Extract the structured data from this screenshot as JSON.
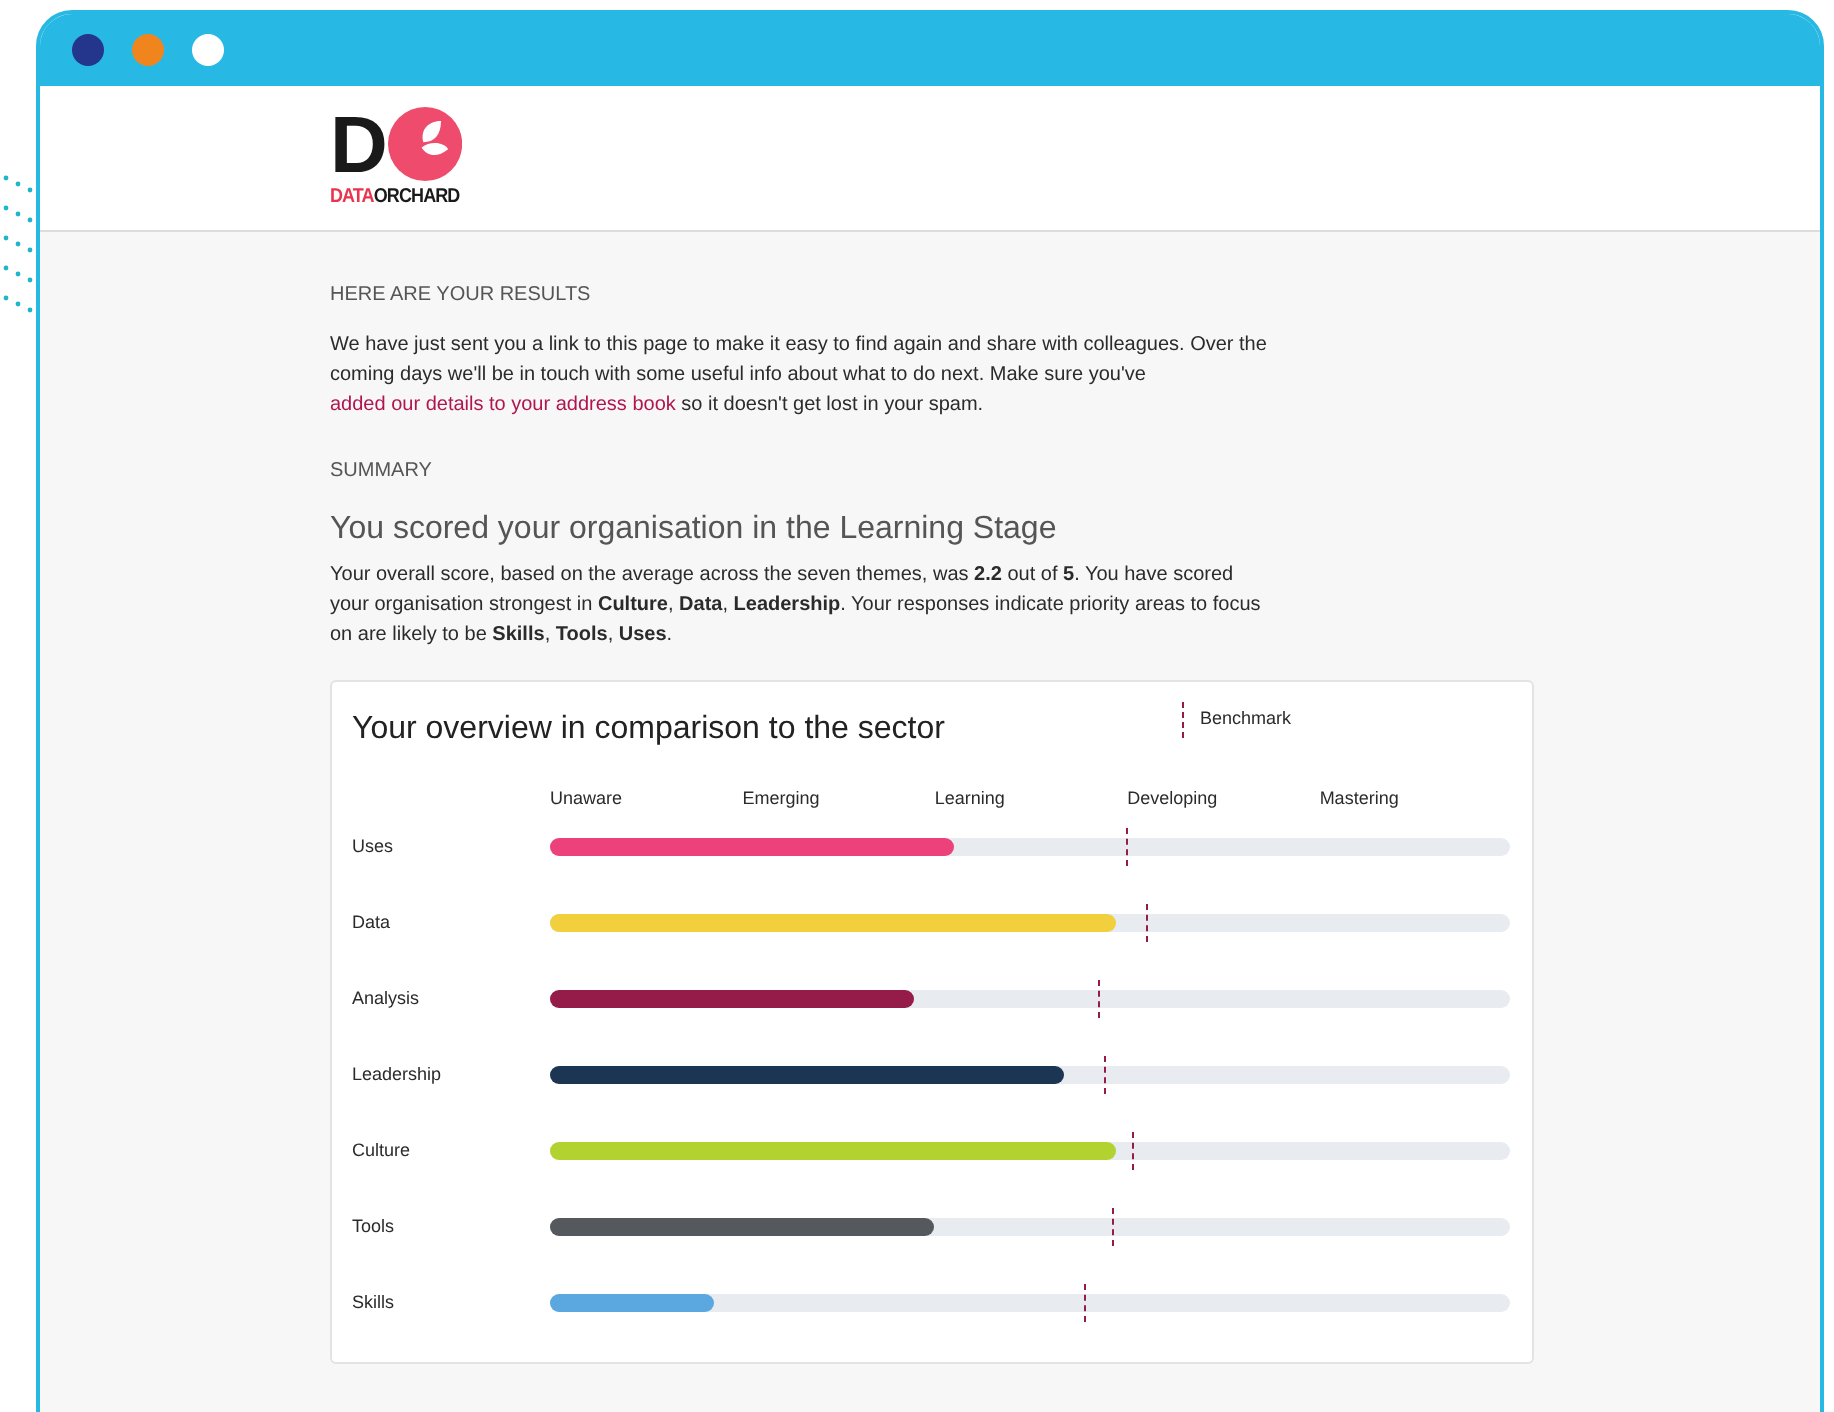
{
  "logo": {
    "letter": "D",
    "word_1": "DATA",
    "word_2": "ORCHARD"
  },
  "results": {
    "heading": "HERE ARE YOUR RESULTS",
    "text_before": "We have just sent you a link to this page to make it easy to find again and share with colleagues. Over the coming days we'll be in touch with some useful info about what to do next. Make sure you've",
    "link": "added our details to your address book",
    "text_after": "so it doesn't get lost in your spam."
  },
  "summary": {
    "heading": "SUMMARY",
    "title": "You scored your organisation in the Learning Stage",
    "text": "Your overall score, based on the average across the seven themes, was **2.2** out of **5**. You have scored your organisation strongest in **Culture**, **Data**, **Leadership**. Your responses indicate priority areas to focus on are likely to be **Skills**, **Tools**, **Uses**."
  },
  "overview": {
    "title": "Your overview in comparison to the sector",
    "legend": "Benchmark",
    "stages": [
      "Unaware",
      "Emerging",
      "Learning",
      "Developing",
      "Mastering"
    ],
    "themes": [
      {
        "name": "Uses",
        "color": "#ec417a",
        "level": 0.42,
        "benchmark": {
          "level": 0.6
        }
      },
      {
        "name": "Data",
        "color": "#f2cf3c",
        "level": 0.59,
        "benchmark": {
          "level": 0.62
        }
      },
      {
        "name": "Analysis",
        "color": "#951b48",
        "level": 0.38,
        "benchmark": {
          "level": 0.57
        }
      },
      {
        "name": "Leadership",
        "color": "#1b3553",
        "level": 0.535,
        "benchmark": {
          "level": 0.577
        }
      },
      {
        "name": "Culture",
        "color": "#b2d22f",
        "level": 0.59,
        "benchmark": {
          "level": 0.607
        }
      },
      {
        "name": "Tools",
        "color": "#55585c",
        "level": 0.4,
        "benchmark": {
          "level": 0.586
        }
      },
      {
        "name": "Skills",
        "color": "#5aa8df",
        "level": 0.17,
        "benchmark": {
          "level": 0.556
        }
      }
    ]
  }
}
